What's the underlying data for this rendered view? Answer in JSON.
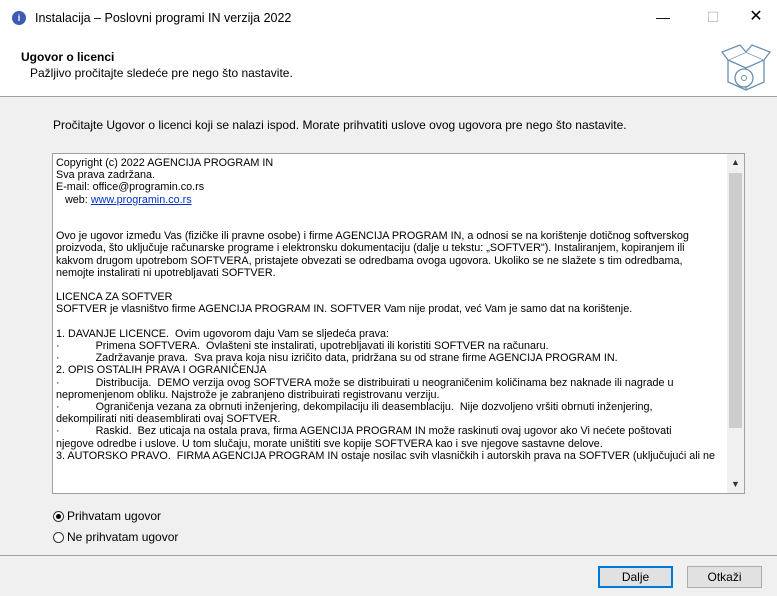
{
  "window": {
    "title": "Instalacija – Poslovni programi IN verzija 2022",
    "icon_glyph": "i",
    "minimize": "—",
    "maximize": "☐",
    "close": "✕"
  },
  "header": {
    "title": "Ugovor o licenci",
    "subtitle": "Pažljivo pročitajte sledeće pre nego što nastavite."
  },
  "instruction": "Pročitajte Ugovor o licenci koji se nalazi ispod. Morate prihvatiti uslove ovog ugovora pre nego što nastavite.",
  "license": {
    "lines_before_link": "Copyright (c) 2022 AGENCIJA PROGRAM IN\nSva prava zadržana.\nE-mail: office@programin.co.rs\n   web: ",
    "link": "www.programin.co.rs",
    "lines_after_link": "\n\n\nOvo je ugovor između Vas (fizičke ili pravne osobe) i firme AGENCIJA PROGRAM IN, a odnosi se na korištenje dotičnog softverskog\nproizvoda, što uključuje računarske programe i elektronsku dokumentaciju (dalje u tekstu: „SOFTVER\"). Instaliranjem, kopiranjem ili\nkakvom drugom upotrebom SOFTVERA, pristajete obvezati se odredbama ovoga ugovora. Ukoliko se ne slažete s tim odredbama,\nnemojte instalirati ni upotrebljavati SOFTVER.\n\nLICENCA ZA SOFTVER\nSOFTVER je vlasništvo firme AGENCIJA PROGRAM IN. SOFTVER Vam nije prodat, već Vam je samo dat na korištenje.\n\n1. DAVANJE LICENCE.  Ovim ugovorom daju Vam se sljedeća prava:\n·            Primena SOFTVERA.  Ovlašteni ste instalirati, upotrebljavati ili koristiti SOFTVER na računaru.\n·            Zadržavanje prava.  Sva prava koja nisu izričito data, pridržana su od strane firme AGENCIJA PROGRAM IN.\n2. OPIS OSTALIH PRAVA I OGRANIČENJA\n·            Distribucija.  DEMO verzija ovog SOFTVERA može se distribuirati u neograničenim količinama bez naknade ili nagrade u\nnepromenjenom obliku. Najstrože je zabranjeno distribuirati registrovanu verziju.\n·            Ograničenja vezana za obrnuti inženjering, dekompilaciju ili deasemblaciju.  Nije dozvoljeno vršiti obrnuti inženjering,\ndekompilirati niti deasemblirati ovaj SOFTVER.\n·            Raskid.  Bez uticaja na ostala prava, firma AGENCIJA PROGRAM IN može raskinuti ovaj ugovor ako Vi nećete poštovati\nnjegove odredbe i uslove. U tom slučaju, morate uništiti sve kopije SOFTVERA kao i sve njegove sastavne delove.\n3. AUTORSKO PRAVO.  FIRMA AGENCIJA PROGRAM IN ostaje nosilac svih vlasničkih i autorskih prava na SOFTVER (uključujući ali ne"
  },
  "scrollbar": {
    "up_glyph": "▲",
    "down_glyph": "▼",
    "position_fraction": 0.0
  },
  "options": {
    "accept": "Prihvatam ugovor",
    "reject": "Ne prihvatam ugovor",
    "selected": "accept"
  },
  "buttons": {
    "next": "Dalje",
    "cancel": "Otkaži"
  }
}
